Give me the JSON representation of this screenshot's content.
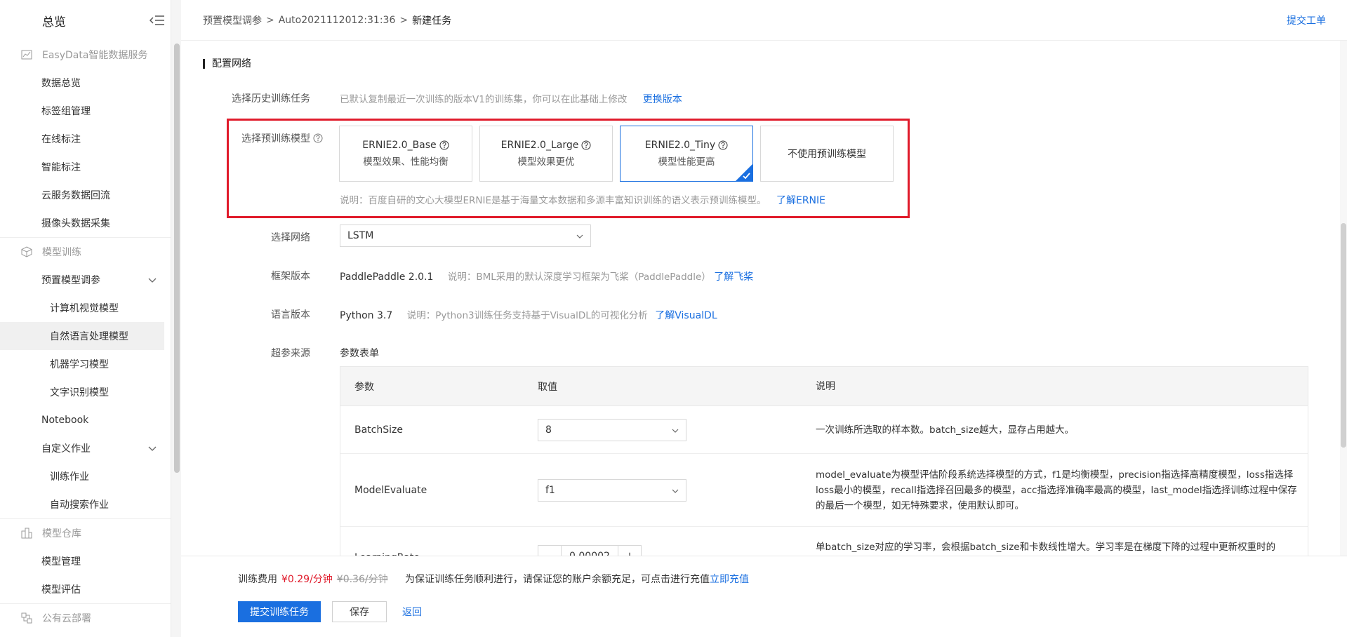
{
  "sidebar": {
    "title": "总览",
    "sections": [
      {
        "label": "EasyData智能数据服务",
        "icon": "chart-icon"
      },
      {
        "label": "模型训练",
        "icon": "cube-icon"
      },
      {
        "label": "模型仓库",
        "icon": "warehouse-icon"
      },
      {
        "label": "公有云部署",
        "icon": "cloud-deploy-icon"
      }
    ],
    "easydata_items": [
      "数据总览",
      "标签组管理",
      "在线标注",
      "智能标注",
      "云服务数据回流",
      "摄像头数据采集"
    ],
    "train_items": {
      "preset": "预置模型调参",
      "preset_sub": [
        "计算机视觉模型",
        "自然语言处理模型",
        "机器学习模型",
        "文字识别模型"
      ],
      "notebook": "Notebook",
      "custom": "自定义作业",
      "custom_sub": [
        "训练作业",
        "自动搜索作业"
      ]
    },
    "repo_items": [
      "模型管理",
      "模型评估"
    ]
  },
  "breadcrumb": [
    "预置模型调参",
    "Auto2021112012:31:36",
    "新建任务"
  ],
  "submit_ticket": "提交工单",
  "section_title": "配置网络",
  "history": {
    "label": "选择历史训练任务",
    "hint": "已默认复制最近一次训练的版本V1的训练集，你可以在此基础上修改",
    "link": "更换版本"
  },
  "pretrain": {
    "label": "选择预训练模型",
    "cards": [
      {
        "name": "ERNIE2.0_Base",
        "desc": "模型效果、性能均衡"
      },
      {
        "name": "ERNIE2.0_Large",
        "desc": "模型效果更优"
      },
      {
        "name": "ERNIE2.0_Tiny",
        "desc": "模型性能更高"
      },
      {
        "name": "不使用预训练模型",
        "desc": ""
      }
    ],
    "hint": "说明：百度自研的文心大模型ERNIE是基于海量文本数据和多源丰富知识训练的语义表示预训练模型。",
    "link": "了解ERNIE"
  },
  "network": {
    "label": "选择网络",
    "value": "LSTM"
  },
  "framework": {
    "label": "框架版本",
    "value": "PaddlePaddle 2.0.1",
    "hint": "说明：BML采用的默认深度学习框架为飞桨（PaddlePaddle）",
    "link": "了解飞桨"
  },
  "language": {
    "label": "语言版本",
    "value": "Python 3.7",
    "hint": "说明：Python3训练任务支持基于VisualDL的可视化分析",
    "link": "了解VisualDL"
  },
  "hyper": {
    "label": "超参来源",
    "value": "参数表单"
  },
  "table": {
    "headers": [
      "参数",
      "取值",
      "说明"
    ],
    "rows": [
      {
        "param": "BatchSize",
        "value": "8",
        "desc": "一次训练所选取的样本数。batch_size越大，显存占用越大。"
      },
      {
        "param": "ModelEvaluate",
        "value": "f1",
        "desc": "model_evaluate为模型评估阶段系统选择模型的方式，f1是均衡模型，precision指选择高精度模型，loss指选择loss最小的模型，recall指选择召回最多的模型，acc指选择准确率最高的模型，last_model指选择训练过程中保存的最后一个模型，如无特殊要求，使用默认即可。"
      },
      {
        "param": "LearningRate",
        "value": "0.00002",
        "desc": "单batch_size对应的学习率，会根据batch_size和卡数线性增大。学习率是在梯度下降的过程中更新权重时的"
      }
    ]
  },
  "footer": {
    "fee_label": "训练费用",
    "fee_now": "¥0.29/分钟",
    "fee_old": "¥0.36/分钟",
    "notice": "为保证训练任务顺利进行，请保证您的账户余额充足，可点击进行充值",
    "recharge": "立即充值",
    "submit": "提交训练任务",
    "save": "保存",
    "back": "返回"
  },
  "colors": {
    "accent": "#1a6fe0",
    "highlight": "#e01b2b"
  }
}
